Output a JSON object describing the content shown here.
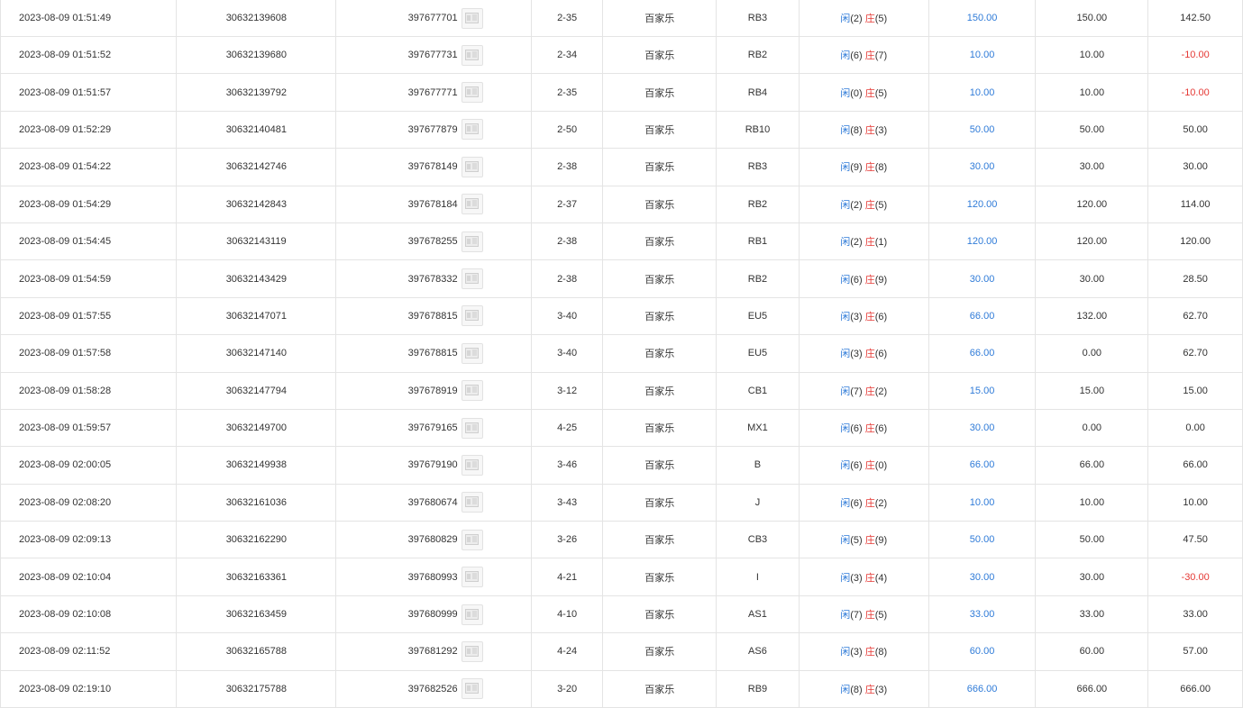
{
  "colors": {
    "player": "#2f7bd8",
    "banker": "#e53935",
    "bet_amount": "#2f7bd8",
    "negative": "#e53935",
    "border": "#e4e4e4"
  },
  "rows": [
    {
      "time": "2023-08-09 01:51:49",
      "bet_id": "30632139608",
      "order_id": "397677701",
      "round": "2-35",
      "game": "百家乐",
      "table": "RB3",
      "player_label": "闲",
      "player_score": "(2)",
      "banker_label": "庄",
      "banker_score": "(5)",
      "bet_amount": "150.00",
      "valid_amount": "150.00",
      "payout": "142.50",
      "payout_negative": false
    },
    {
      "time": "2023-08-09 01:51:52",
      "bet_id": "30632139680",
      "order_id": "397677731",
      "round": "2-34",
      "game": "百家乐",
      "table": "RB2",
      "player_label": "闲",
      "player_score": "(6)",
      "banker_label": "庄",
      "banker_score": "(7)",
      "bet_amount": "10.00",
      "valid_amount": "10.00",
      "payout": "-10.00",
      "payout_negative": true
    },
    {
      "time": "2023-08-09 01:51:57",
      "bet_id": "30632139792",
      "order_id": "397677771",
      "round": "2-35",
      "game": "百家乐",
      "table": "RB4",
      "player_label": "闲",
      "player_score": "(0)",
      "banker_label": "庄",
      "banker_score": "(5)",
      "bet_amount": "10.00",
      "valid_amount": "10.00",
      "payout": "-10.00",
      "payout_negative": true
    },
    {
      "time": "2023-08-09 01:52:29",
      "bet_id": "30632140481",
      "order_id": "397677879",
      "round": "2-50",
      "game": "百家乐",
      "table": "RB10",
      "player_label": "闲",
      "player_score": "(8)",
      "banker_label": "庄",
      "banker_score": "(3)",
      "bet_amount": "50.00",
      "valid_amount": "50.00",
      "payout": "50.00",
      "payout_negative": false
    },
    {
      "time": "2023-08-09 01:54:22",
      "bet_id": "30632142746",
      "order_id": "397678149",
      "round": "2-38",
      "game": "百家乐",
      "table": "RB3",
      "player_label": "闲",
      "player_score": "(9)",
      "banker_label": "庄",
      "banker_score": "(8)",
      "bet_amount": "30.00",
      "valid_amount": "30.00",
      "payout": "30.00",
      "payout_negative": false
    },
    {
      "time": "2023-08-09 01:54:29",
      "bet_id": "30632142843",
      "order_id": "397678184",
      "round": "2-37",
      "game": "百家乐",
      "table": "RB2",
      "player_label": "闲",
      "player_score": "(2)",
      "banker_label": "庄",
      "banker_score": "(5)",
      "bet_amount": "120.00",
      "valid_amount": "120.00",
      "payout": "114.00",
      "payout_negative": false
    },
    {
      "time": "2023-08-09 01:54:45",
      "bet_id": "30632143119",
      "order_id": "397678255",
      "round": "2-38",
      "game": "百家乐",
      "table": "RB1",
      "player_label": "闲",
      "player_score": "(2)",
      "banker_label": "庄",
      "banker_score": "(1)",
      "bet_amount": "120.00",
      "valid_amount": "120.00",
      "payout": "120.00",
      "payout_negative": false
    },
    {
      "time": "2023-08-09 01:54:59",
      "bet_id": "30632143429",
      "order_id": "397678332",
      "round": "2-38",
      "game": "百家乐",
      "table": "RB2",
      "player_label": "闲",
      "player_score": "(6)",
      "banker_label": "庄",
      "banker_score": "(9)",
      "bet_amount": "30.00",
      "valid_amount": "30.00",
      "payout": "28.50",
      "payout_negative": false
    },
    {
      "time": "2023-08-09 01:57:55",
      "bet_id": "30632147071",
      "order_id": "397678815",
      "round": "3-40",
      "game": "百家乐",
      "table": "EU5",
      "player_label": "闲",
      "player_score": "(3)",
      "banker_label": "庄",
      "banker_score": "(6)",
      "bet_amount": "66.00",
      "valid_amount": "132.00",
      "payout": "62.70",
      "payout_negative": false
    },
    {
      "time": "2023-08-09 01:57:58",
      "bet_id": "30632147140",
      "order_id": "397678815",
      "round": "3-40",
      "game": "百家乐",
      "table": "EU5",
      "player_label": "闲",
      "player_score": "(3)",
      "banker_label": "庄",
      "banker_score": "(6)",
      "bet_amount": "66.00",
      "valid_amount": "0.00",
      "payout": "62.70",
      "payout_negative": false
    },
    {
      "time": "2023-08-09 01:58:28",
      "bet_id": "30632147794",
      "order_id": "397678919",
      "round": "3-12",
      "game": "百家乐",
      "table": "CB1",
      "player_label": "闲",
      "player_score": "(7)",
      "banker_label": "庄",
      "banker_score": "(2)",
      "bet_amount": "15.00",
      "valid_amount": "15.00",
      "payout": "15.00",
      "payout_negative": false
    },
    {
      "time": "2023-08-09 01:59:57",
      "bet_id": "30632149700",
      "order_id": "397679165",
      "round": "4-25",
      "game": "百家乐",
      "table": "MX1",
      "player_label": "闲",
      "player_score": "(6)",
      "banker_label": "庄",
      "banker_score": "(6)",
      "bet_amount": "30.00",
      "valid_amount": "0.00",
      "payout": "0.00",
      "payout_negative": false
    },
    {
      "time": "2023-08-09 02:00:05",
      "bet_id": "30632149938",
      "order_id": "397679190",
      "round": "3-46",
      "game": "百家乐",
      "table": "B",
      "player_label": "闲",
      "player_score": "(6)",
      "banker_label": "庄",
      "banker_score": "(0)",
      "bet_amount": "66.00",
      "valid_amount": "66.00",
      "payout": "66.00",
      "payout_negative": false
    },
    {
      "time": "2023-08-09 02:08:20",
      "bet_id": "30632161036",
      "order_id": "397680674",
      "round": "3-43",
      "game": "百家乐",
      "table": "J",
      "player_label": "闲",
      "player_score": "(6)",
      "banker_label": "庄",
      "banker_score": "(2)",
      "bet_amount": "10.00",
      "valid_amount": "10.00",
      "payout": "10.00",
      "payout_negative": false
    },
    {
      "time": "2023-08-09 02:09:13",
      "bet_id": "30632162290",
      "order_id": "397680829",
      "round": "3-26",
      "game": "百家乐",
      "table": "CB3",
      "player_label": "闲",
      "player_score": "(5)",
      "banker_label": "庄",
      "banker_score": "(9)",
      "bet_amount": "50.00",
      "valid_amount": "50.00",
      "payout": "47.50",
      "payout_negative": false
    },
    {
      "time": "2023-08-09 02:10:04",
      "bet_id": "30632163361",
      "order_id": "397680993",
      "round": "4-21",
      "game": "百家乐",
      "table": "I",
      "player_label": "闲",
      "player_score": "(3)",
      "banker_label": "庄",
      "banker_score": "(4)",
      "bet_amount": "30.00",
      "valid_amount": "30.00",
      "payout": "-30.00",
      "payout_negative": true
    },
    {
      "time": "2023-08-09 02:10:08",
      "bet_id": "30632163459",
      "order_id": "397680999",
      "round": "4-10",
      "game": "百家乐",
      "table": "AS1",
      "player_label": "闲",
      "player_score": "(7)",
      "banker_label": "庄",
      "banker_score": "(5)",
      "bet_amount": "33.00",
      "valid_amount": "33.00",
      "payout": "33.00",
      "payout_negative": false
    },
    {
      "time": "2023-08-09 02:11:52",
      "bet_id": "30632165788",
      "order_id": "397681292",
      "round": "4-24",
      "game": "百家乐",
      "table": "AS6",
      "player_label": "闲",
      "player_score": "(3)",
      "banker_label": "庄",
      "banker_score": "(8)",
      "bet_amount": "60.00",
      "valid_amount": "60.00",
      "payout": "57.00",
      "payout_negative": false
    },
    {
      "time": "2023-08-09 02:19:10",
      "bet_id": "30632175788",
      "order_id": "397682526",
      "round": "3-20",
      "game": "百家乐",
      "table": "RB9",
      "player_label": "闲",
      "player_score": "(8)",
      "banker_label": "庄",
      "banker_score": "(3)",
      "bet_amount": "666.00",
      "valid_amount": "666.00",
      "payout": "666.00",
      "payout_negative": false
    }
  ]
}
